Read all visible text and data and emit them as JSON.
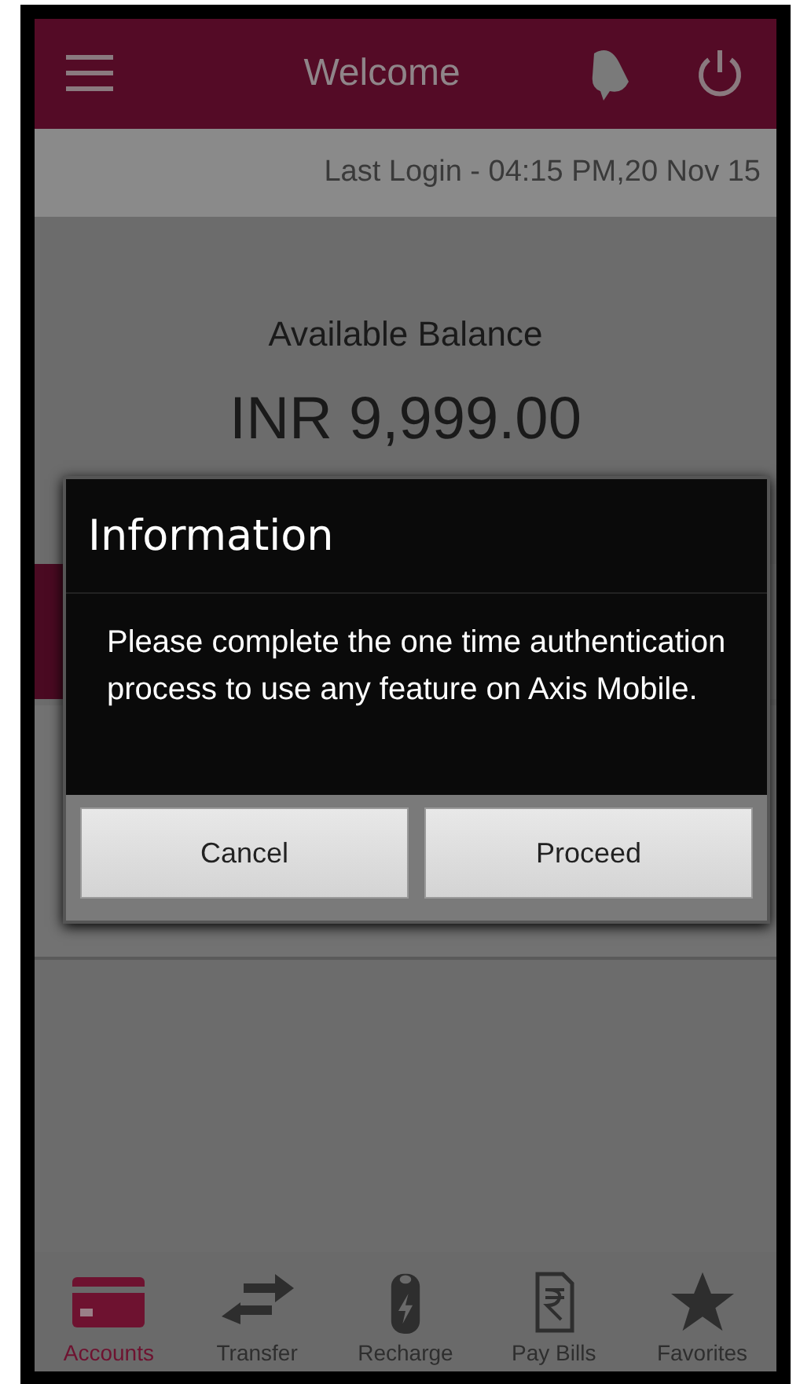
{
  "header": {
    "title": "Welcome"
  },
  "last_login": "Last Login - 04:15 PM,20 Nov 15",
  "balance": {
    "label": "Available Balance",
    "amount": "INR 9,999.00"
  },
  "dialog": {
    "title": "Information",
    "message": "Please complete the one time authentication process to use any feature on Axis Mobile.",
    "buttons": [
      "Cancel",
      "Proceed"
    ]
  },
  "nav": [
    {
      "kind": "card",
      "label": "Accounts",
      "selected": true
    },
    {
      "kind": "transfer",
      "label": "Transfer",
      "selected": false
    },
    {
      "kind": "battery",
      "label": "Recharge",
      "selected": false
    },
    {
      "kind": "bill",
      "label": "Pay Bills",
      "selected": false
    },
    {
      "kind": "star",
      "label": "Favorites",
      "selected": false
    }
  ]
}
